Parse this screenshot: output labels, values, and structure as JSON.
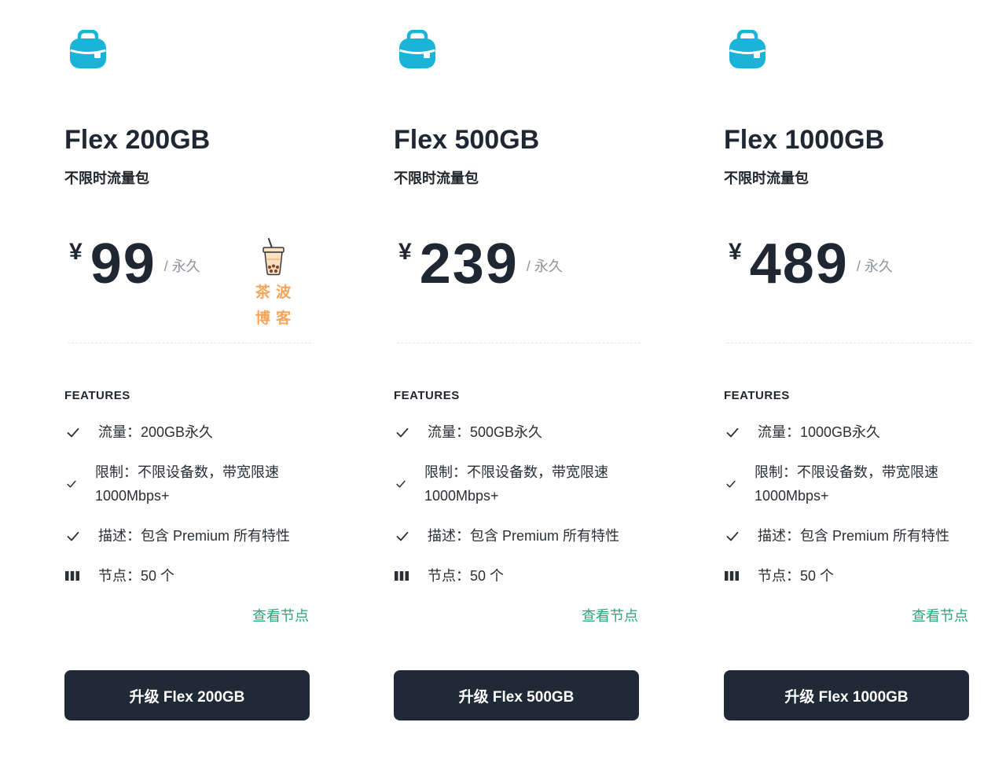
{
  "plans": [
    {
      "icon": "bag-icon",
      "name": "Flex 200GB",
      "subtitle": "不限时流量包",
      "currency": "¥",
      "price": 99,
      "period": "/ 永久",
      "features_heading": "FEATURES",
      "features": [
        {
          "icon": "check-icon",
          "text": "流量：200GB永久"
        },
        {
          "icon": "check-icon",
          "text": "限制：不限设备数，带宽限速 1000Mbps+"
        },
        {
          "icon": "check-icon",
          "text": "描述：包含 Premium 所有特性"
        },
        {
          "icon": "server-bars-icon",
          "text": "节点：50 个"
        }
      ],
      "link": "查看节点",
      "button": "升级 Flex 200GB"
    },
    {
      "icon": "bag-icon",
      "name": "Flex 500GB",
      "subtitle": "不限时流量包",
      "currency": "¥",
      "price": 239,
      "period": "/ 永久",
      "features_heading": "FEATURES",
      "features": [
        {
          "icon": "check-icon",
          "text": "流量：500GB永久"
        },
        {
          "icon": "check-icon",
          "text": "限制：不限设备数，带宽限速 1000Mbps+"
        },
        {
          "icon": "check-icon",
          "text": "描述：包含 Premium 所有特性"
        },
        {
          "icon": "server-bars-icon",
          "text": "节点：50 个"
        }
      ],
      "link": "查看节点",
      "button": "升级 Flex 500GB"
    },
    {
      "icon": "bag-icon",
      "name": "Flex 1000GB",
      "subtitle": "不限时流量包",
      "currency": "¥",
      "price": 489,
      "period": "/ 永久",
      "features_heading": "FEATURES",
      "features": [
        {
          "icon": "check-icon",
          "text": "流量：1000GB永久"
        },
        {
          "icon": "check-icon",
          "text": "限制：不限设备数，带宽限速 1000Mbps+"
        },
        {
          "icon": "check-icon",
          "text": "描述：包含 Premium 所有特性"
        },
        {
          "icon": "server-bars-icon",
          "text": "节点：50 个"
        }
      ],
      "link": "查看节点",
      "button": "升级 Flex 1000GB"
    }
  ],
  "watermark": {
    "icon": "bubble-tea-icon",
    "line1": "茶 波",
    "line2": "博 客"
  },
  "colors": {
    "icon": "#19b4d8",
    "text": "#1f2732",
    "muted": "#8e959c",
    "link": "#27a776",
    "button_bg": "#1f2a36",
    "button_text": "#ffffff",
    "watermark": "#f5a55a"
  }
}
